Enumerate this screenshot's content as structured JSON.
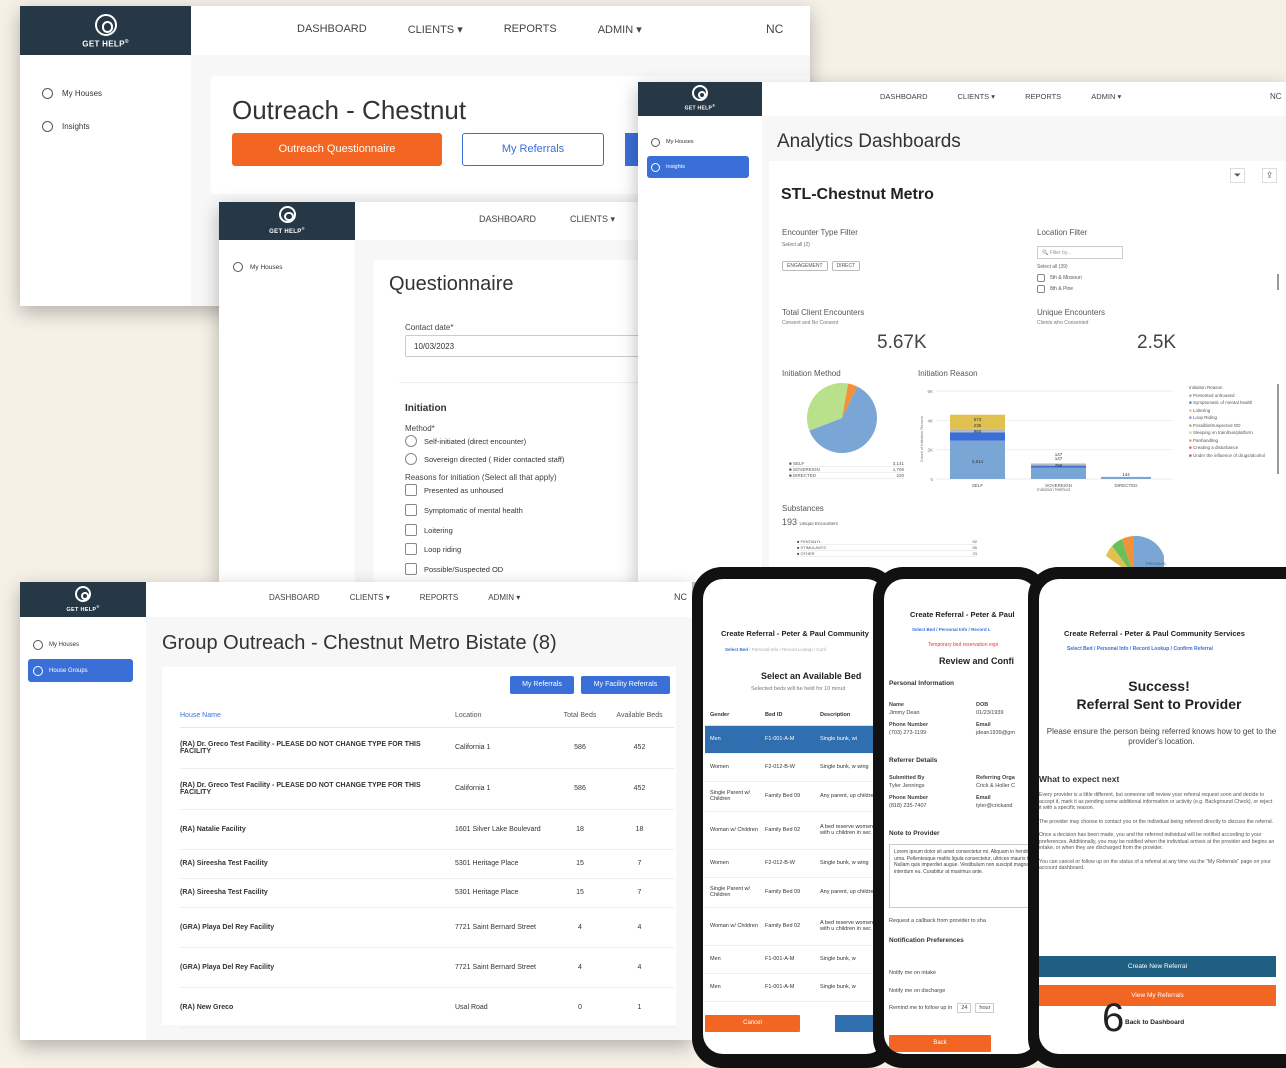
{
  "logo": {
    "text": "GET HELP",
    "reg": "®"
  },
  "nav": {
    "dashboard": "DASHBOARD",
    "clients": "CLIENTS",
    "reports": "REPORTS",
    "admin": "ADMIN",
    "user": "NC"
  },
  "win1": {
    "sidebar": [
      {
        "label": "My Houses"
      },
      {
        "label": "Insights"
      }
    ],
    "title": "Outreach - Chestnut",
    "btn_questionnaire": "Outreach Questionnaire",
    "btn_referrals": "My Referrals"
  },
  "win2": {
    "sidebar": [
      {
        "label": "My Houses"
      }
    ],
    "title": "Questionnaire",
    "contact_label": "Contact date*",
    "contact_value": "10/03/2023",
    "section": "Initiation",
    "method_label": "Method*",
    "methods": [
      "Self-initiated (direct encounter)",
      "Sovereign directed ( Rider contacted staff)"
    ],
    "reasons_label": "Reasons for initiation (Select all that apply)",
    "reasons": [
      "Presented as unhoused",
      "Symptomatic of mental health",
      "Loitering",
      "Loop riding",
      "Possible/Suspected OD"
    ]
  },
  "win3": {
    "sidebar": [
      {
        "label": "My Houses"
      },
      {
        "label": "Insights"
      }
    ],
    "title": "Analytics Dashboards",
    "subtitle": "STL-Chestnut Metro",
    "encounter_filter": "Encounter Type Filter",
    "select_all_2": "Select all (2)",
    "pills": [
      "ENGAGEMENT",
      "DIRECT"
    ],
    "location_filter": "Location Filter",
    "filter_placeholder": "Filter by...",
    "select_all_39": "Select all (39)",
    "locations": [
      "5th & Missouri",
      "8th & Pine"
    ],
    "total_label": "Total Client Encounters",
    "total_sub": "Consent and No Consent",
    "total_value": "5.67K",
    "unique_label": "Unique Encounters",
    "unique_sub": "Clients who Consented",
    "unique_value": "2.5K",
    "init_method": "Initiation Method",
    "init_reason": "Initiation Reason",
    "pie_legend": [
      {
        "label": "SELF",
        "value": "3,141"
      },
      {
        "label": "SOVEREIGN",
        "value": "1,706"
      },
      {
        "label": "DIRECTED",
        "value": "220"
      }
    ],
    "bar_yticks": [
      "6K",
      "4K",
      "2K",
      "0"
    ],
    "bar_ylabel": "Count of Initiation Reason",
    "bar_cats": [
      "SELF",
      "SOVEREIGN",
      "DIRECTED"
    ],
    "bar_xlabel": "Initiation Method",
    "bar_labels": {
      "self": [
        "960",
        "235",
        "573",
        "2,614"
      ],
      "sov": [
        "147",
        "147",
        "766"
      ],
      "dir": [
        "144"
      ]
    },
    "reason_legend_title": "Initiation Reason",
    "reason_legend": [
      "Presented unhoused",
      "Symptomatic of mental health",
      "Loitering",
      "Loop Riding",
      "Possible/Suspected OD",
      "Sleeping on train/bus/platform",
      "Panhandling",
      "Creating a disturbance",
      "Under the influence of drugs/alcohol"
    ],
    "substances": "Substances",
    "subst_count": "193",
    "subst_sub": "Unique Encounters",
    "subst_items": [
      {
        "label": "FENTANYL",
        "value": "92"
      },
      {
        "label": "STIMULANTS",
        "value": "55"
      },
      {
        "label": "OTHER",
        "value": "23"
      }
    ],
    "subst_pie_label": "FENTANYL"
  },
  "win4": {
    "sidebar": [
      {
        "label": "My Houses"
      },
      {
        "label": "House Groups"
      }
    ],
    "title": "Group Outreach - Chestnut Metro Bistate (8)",
    "btn_referrals": "My Referrals",
    "btn_facility": "My Facility Referrals",
    "columns": [
      "House Name",
      "Location",
      "Total Beds",
      "Available Beds"
    ],
    "rows": [
      {
        "name": "(RA) Dr. Greco Test Facility - PLEASE DO NOT CHANGE TYPE FOR THIS FACILITY",
        "loc": "California 1",
        "total": "586",
        "avail": "452"
      },
      {
        "name": "(RA) Dr. Greco Test Facility - PLEASE DO NOT CHANGE TYPE FOR THIS FACILITY",
        "loc": "California 1",
        "total": "586",
        "avail": "452"
      },
      {
        "name": "(RA) Natalie Facility",
        "loc": "1601 Silver Lake Boulevard",
        "total": "18",
        "avail": "18"
      },
      {
        "name": "(RA) Sireesha Test Facility",
        "loc": "5301 Heritage Place",
        "total": "15",
        "avail": "7"
      },
      {
        "name": "(RA) Sireesha Test Facility",
        "loc": "5301 Heritage Place",
        "total": "15",
        "avail": "7"
      },
      {
        "name": "(GRA) Playa Del Rey Facility",
        "loc": "7721 Saint Bernard Street",
        "total": "4",
        "avail": "4"
      },
      {
        "name": "(GRA) Playa Del Rey Facility",
        "loc": "7721 Saint Bernard Street",
        "total": "4",
        "avail": "4"
      },
      {
        "name": "(RA) New Greco",
        "loc": "Usal Road",
        "total": "0",
        "avail": "1"
      }
    ]
  },
  "phone1": {
    "title": "Create Referral - Peter & Paul Community",
    "crumbs": [
      "Select Bed",
      "Personal Info",
      "Record Lookup",
      "Conf"
    ],
    "heading": "Select an Available Bed",
    "sub": "Selected beds will be held for 10 minut",
    "columns": [
      "Gender",
      "Bed ID",
      "Description"
    ],
    "rows": [
      {
        "g": "Men",
        "id": "F1-001-A-M",
        "d": "Single bunk, wi"
      },
      {
        "g": "Women",
        "id": "F2-012-B-W",
        "d": "Single bunk, w wing"
      },
      {
        "g": "Single Parent w/ Children",
        "id": "Family Bed 09",
        "d": "Any parent, up children"
      },
      {
        "g": "Woman w/ Children",
        "id": "Family Bed 02",
        "d": "A bed reserve women with u children in sec"
      },
      {
        "g": "Women",
        "id": "F2-012-B-W",
        "d": "Single bunk, w wing"
      },
      {
        "g": "Single Parent w/ Children",
        "id": "Family Bed 09",
        "d": "Any parent, up children"
      },
      {
        "g": "Woman w/ Children",
        "id": "Family Bed 02",
        "d": "A bed reserve women with u children in sec"
      },
      {
        "g": "Men",
        "id": "F1-001-A-M",
        "d": "Single bunk, w"
      },
      {
        "g": "Men",
        "id": "F1-001-A-M",
        "d": "Single bunk, w"
      }
    ],
    "cancel": "Cancel"
  },
  "phone2": {
    "title": "Create Referral - Peter & Paul",
    "crumbs": [
      "Select Bed",
      "Personal Info",
      "Record L"
    ],
    "warning": "Temporary bed reservation expi",
    "heading": "Review and Confi",
    "personal": "Personal Information",
    "name_l": "Name",
    "name_v": "Jimmy Dean",
    "dob_l": "DOB",
    "dob_v": "01/23/1939",
    "phone_l": "Phone Number",
    "phone_v": "(703) 273-1199",
    "email_l": "Email",
    "email_v": "jdean1939@gm",
    "referrer": "Referrer Details",
    "sub_l": "Submitted By",
    "sub_v": "Tyler Jennings",
    "org_l": "Referring Orga",
    "org_v": "Crick & Holler C",
    "rphone_l": "Phone Number",
    "rphone_v": "(818) 235-7407",
    "remail_l": "Email",
    "remail_v": "tyler@crickand",
    "note": "Note to Provider",
    "lorem": "Lorem ipsum dolor sit amet consectetur mi. Aliquam in hendrerit urna. Pellentesque mattis ligula consectetur, ultrices mauris tellus. Nullam quis imperdiet augue. Vestibulum non suscipit magna interdum eu. Curabitur at maximus ante.",
    "callback": "Request a callback from provider to sha",
    "notif": "Notification Preferences",
    "intake": "Notify me on intake",
    "discharge": "Notify me on discharge",
    "remind": "Remind me to follow up in",
    "remind_val": "24",
    "remind_unit": "hour",
    "back": "Back"
  },
  "phone3": {
    "title": "Create Referral - Peter & Paul Community Services",
    "crumbs": [
      "Select Bed",
      "Personal Info",
      "Record Lookup",
      "Confirm Referral"
    ],
    "success": "Success!",
    "sent": "Referral Sent to Provider",
    "ensure": "Please ensure the person being referred knows how to get to the provider's location.",
    "expect": "What to expect next",
    "p1": "Every provider is a little different, but someone will review your referral request soon and decide to accept it, mark it as pending some additional information or activity (e.g. Background Check), or reject it with a specific reason.",
    "p2": "The provider may choose to contact you or the individual being referred directly to discuss the referral.",
    "p3": "Once a decision has been made, you and the referred individual will be notified according to your preferences. Additionally, you may be notified when the individual arrives at the provider and begins an intake, or when they are discharged from the provider.",
    "p4": "You can cancel or follow up on the status of a referral at any time via the \"My Referrals\" page on your account dashboard.",
    "create": "Create New Referral",
    "view": "View My Referrals",
    "back_dash": "Back to Dashboard"
  },
  "page_number": "6",
  "colors": {
    "navy": "#263746",
    "orange": "#f26522",
    "blue": "#3b6fd8",
    "pie_blue": "#7aa6d6",
    "pie_green": "#b9e08a",
    "pie_orange": "#f2913a"
  },
  "chart_data": [
    {
      "type": "pie",
      "title": "Initiation Method",
      "categories": [
        "SELF",
        "SOVEREIGN",
        "DIRECTED"
      ],
      "values": [
        3141,
        1706,
        220
      ]
    },
    {
      "type": "bar",
      "title": "Initiation Reason",
      "xlabel": "Initiation Method",
      "ylabel": "Count of Initiation Reason",
      "categories": [
        "SELF",
        "SOVEREIGN",
        "DIRECTED"
      ],
      "ylim": [
        0,
        6000
      ],
      "series": [
        {
          "name": "Presented unhoused",
          "values": [
            2614,
            766,
            144
          ]
        },
        {
          "name": "Symptomatic of mental health",
          "values": [
            573,
            147,
            0
          ]
        },
        {
          "name": "Loitering",
          "values": [
            235,
            147,
            0
          ]
        },
        {
          "name": "Loop Riding",
          "values": [
            960,
            0,
            0
          ]
        }
      ]
    }
  ]
}
